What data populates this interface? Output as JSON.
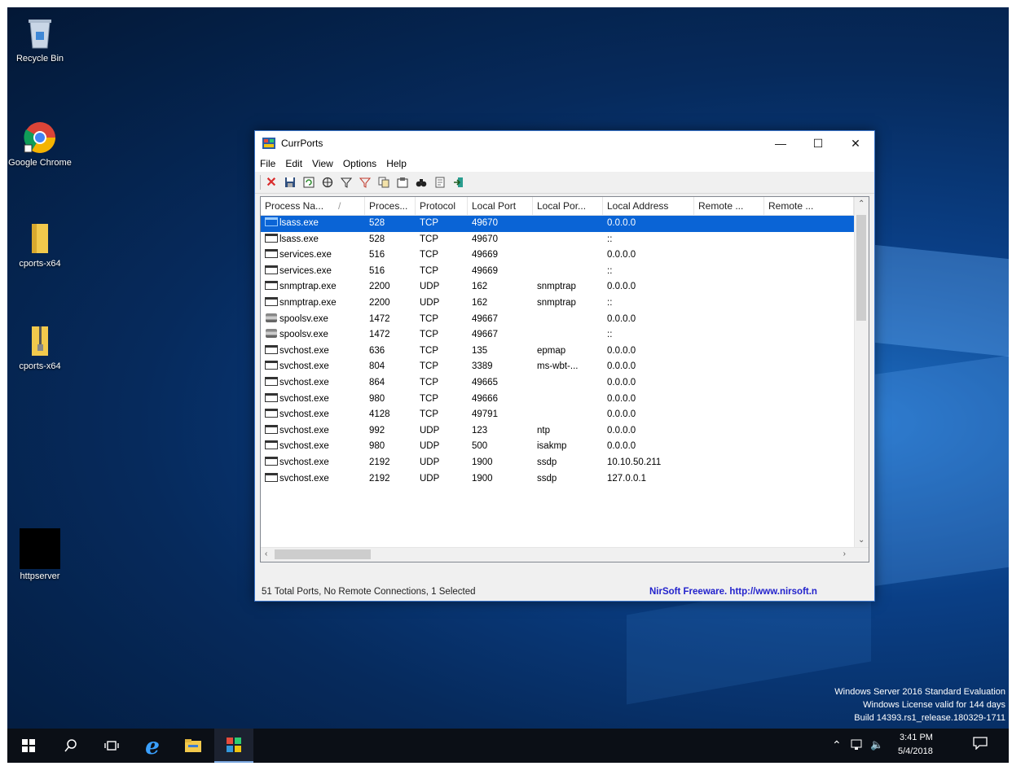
{
  "desktop": {
    "icons": [
      {
        "label": "Recycle Bin"
      },
      {
        "label": "Google Chrome"
      },
      {
        "label": "cports-x64"
      },
      {
        "label": "cports-x64"
      },
      {
        "label": "httpserver"
      }
    ],
    "watermark": [
      "Windows Server 2016 Standard Evaluation",
      "Windows License valid for 144 days",
      "Build 14393.rs1_release.180329-1711"
    ]
  },
  "window": {
    "title": "CurrPorts",
    "controls": {
      "minimize": "—",
      "maximize": "☐",
      "close": "✕"
    },
    "menu": [
      "File",
      "Edit",
      "View",
      "Options",
      "Help"
    ],
    "toolbar_icons": [
      "close-connections-icon",
      "save-icon",
      "refresh-icon",
      "properties-icon",
      "filter-icon",
      "filter-advanced-icon",
      "copy-icon",
      "html-report-icon",
      "find-icon",
      "options-icon",
      "exit-icon"
    ],
    "columns": [
      "Process Na...",
      "Proces...",
      "Protocol",
      "Local Port",
      "Local Por...",
      "Local Address",
      "Remote ...",
      "Remote ..."
    ],
    "sort_indicator": "/",
    "rows": [
      {
        "process": "lsass.exe",
        "pid": "528",
        "protocol": "TCP",
        "local_port": "49670",
        "local_port_name": "",
        "local_address": "0.0.0.0",
        "selected": true,
        "icon": "window"
      },
      {
        "process": "lsass.exe",
        "pid": "528",
        "protocol": "TCP",
        "local_port": "49670",
        "local_port_name": "",
        "local_address": "::",
        "icon": "window"
      },
      {
        "process": "services.exe",
        "pid": "516",
        "protocol": "TCP",
        "local_port": "49669",
        "local_port_name": "",
        "local_address": "0.0.0.0",
        "icon": "window"
      },
      {
        "process": "services.exe",
        "pid": "516",
        "protocol": "TCP",
        "local_port": "49669",
        "local_port_name": "",
        "local_address": "::",
        "icon": "window"
      },
      {
        "process": "snmptrap.exe",
        "pid": "2200",
        "protocol": "UDP",
        "local_port": "162",
        "local_port_name": "snmptrap",
        "local_address": "0.0.0.0",
        "icon": "window"
      },
      {
        "process": "snmptrap.exe",
        "pid": "2200",
        "protocol": "UDP",
        "local_port": "162",
        "local_port_name": "snmptrap",
        "local_address": "::",
        "icon": "window"
      },
      {
        "process": "spoolsv.exe",
        "pid": "1472",
        "protocol": "TCP",
        "local_port": "49667",
        "local_port_name": "",
        "local_address": "0.0.0.0",
        "icon": "printer"
      },
      {
        "process": "spoolsv.exe",
        "pid": "1472",
        "protocol": "TCP",
        "local_port": "49667",
        "local_port_name": "",
        "local_address": "::",
        "icon": "printer"
      },
      {
        "process": "svchost.exe",
        "pid": "636",
        "protocol": "TCP",
        "local_port": "135",
        "local_port_name": "epmap",
        "local_address": "0.0.0.0",
        "icon": "window"
      },
      {
        "process": "svchost.exe",
        "pid": "804",
        "protocol": "TCP",
        "local_port": "3389",
        "local_port_name": "ms-wbt-...",
        "local_address": "0.0.0.0",
        "icon": "window"
      },
      {
        "process": "svchost.exe",
        "pid": "864",
        "protocol": "TCP",
        "local_port": "49665",
        "local_port_name": "",
        "local_address": "0.0.0.0",
        "icon": "window"
      },
      {
        "process": "svchost.exe",
        "pid": "980",
        "protocol": "TCP",
        "local_port": "49666",
        "local_port_name": "",
        "local_address": "0.0.0.0",
        "icon": "window"
      },
      {
        "process": "svchost.exe",
        "pid": "4128",
        "protocol": "TCP",
        "local_port": "49791",
        "local_port_name": "",
        "local_address": "0.0.0.0",
        "icon": "window"
      },
      {
        "process": "svchost.exe",
        "pid": "992",
        "protocol": "UDP",
        "local_port": "123",
        "local_port_name": "ntp",
        "local_address": "0.0.0.0",
        "icon": "window"
      },
      {
        "process": "svchost.exe",
        "pid": "980",
        "protocol": "UDP",
        "local_port": "500",
        "local_port_name": "isakmp",
        "local_address": "0.0.0.0",
        "icon": "window"
      },
      {
        "process": "svchost.exe",
        "pid": "2192",
        "protocol": "UDP",
        "local_port": "1900",
        "local_port_name": "ssdp",
        "local_address": "10.10.50.211",
        "icon": "window"
      },
      {
        "process": "svchost.exe",
        "pid": "2192",
        "protocol": "UDP",
        "local_port": "1900",
        "local_port_name": "ssdp",
        "local_address": "127.0.0.1",
        "icon": "window"
      }
    ],
    "status_left": "51 Total Ports, No Remote Connections, 1 Selected",
    "status_right": "NirSoft Freeware.  http://www.nirsoft.n",
    "selection_color": "#0a64d6"
  },
  "taskbar": {
    "time": "3:41 PM",
    "date": "5/4/2018",
    "tray_icons": [
      "chevron-up-icon",
      "network-icon",
      "volume-muted-icon",
      "action-center-icon"
    ],
    "pinned": [
      "start-icon",
      "search-icon",
      "task-view-icon",
      "internet-explorer-icon",
      "file-explorer-icon",
      "currports-icon"
    ]
  }
}
